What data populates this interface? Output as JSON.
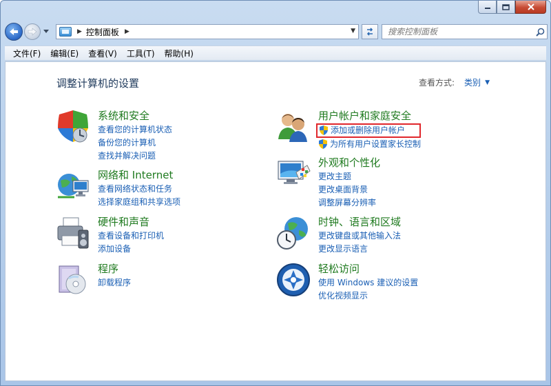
{
  "window": {
    "colors": {
      "accent": "#1a5fb4",
      "category_title": "#1f7a1f",
      "highlight": "#e0262b"
    }
  },
  "address": {
    "path": "控制面板"
  },
  "search": {
    "placeholder": "搜索控制面板"
  },
  "menu": [
    "文件(F)",
    "编辑(E)",
    "查看(V)",
    "工具(T)",
    "帮助(H)"
  ],
  "header": {
    "title": "调整计算机的设置",
    "view_by_label": "查看方式:",
    "view_by_value": "类别"
  },
  "categories": [
    {
      "title": "系统和安全",
      "icon": "shield-icon",
      "links": [
        "查看您的计算机状态",
        "备份您的计算机",
        "查找并解决问题"
      ]
    },
    {
      "title": "网络和 Internet",
      "icon": "network-globe-icon",
      "links": [
        "查看网络状态和任务",
        "选择家庭组和共享选项"
      ]
    },
    {
      "title": "硬件和声音",
      "icon": "printer-icon",
      "links": [
        "查看设备和打印机",
        "添加设备"
      ]
    },
    {
      "title": "程序",
      "icon": "programs-disc-icon",
      "links": [
        "卸载程序"
      ]
    },
    {
      "title": "用户帐户和家庭安全",
      "icon": "users-icon",
      "links": [
        "添加或删除用户帐户",
        "为所有用户设置家长控制"
      ]
    },
    {
      "title": "外观和个性化",
      "icon": "monitor-palette-icon",
      "links": [
        "更改主题",
        "更改桌面背景",
        "调整屏幕分辨率"
      ]
    },
    {
      "title": "时钟、语言和区域",
      "icon": "globe-clock-icon",
      "links": [
        "更改键盘或其他输入法",
        "更改显示语言"
      ]
    },
    {
      "title": "轻松访问",
      "icon": "ease-of-access-icon",
      "links": [
        "使用 Windows 建议的设置",
        "优化视频显示"
      ]
    }
  ]
}
